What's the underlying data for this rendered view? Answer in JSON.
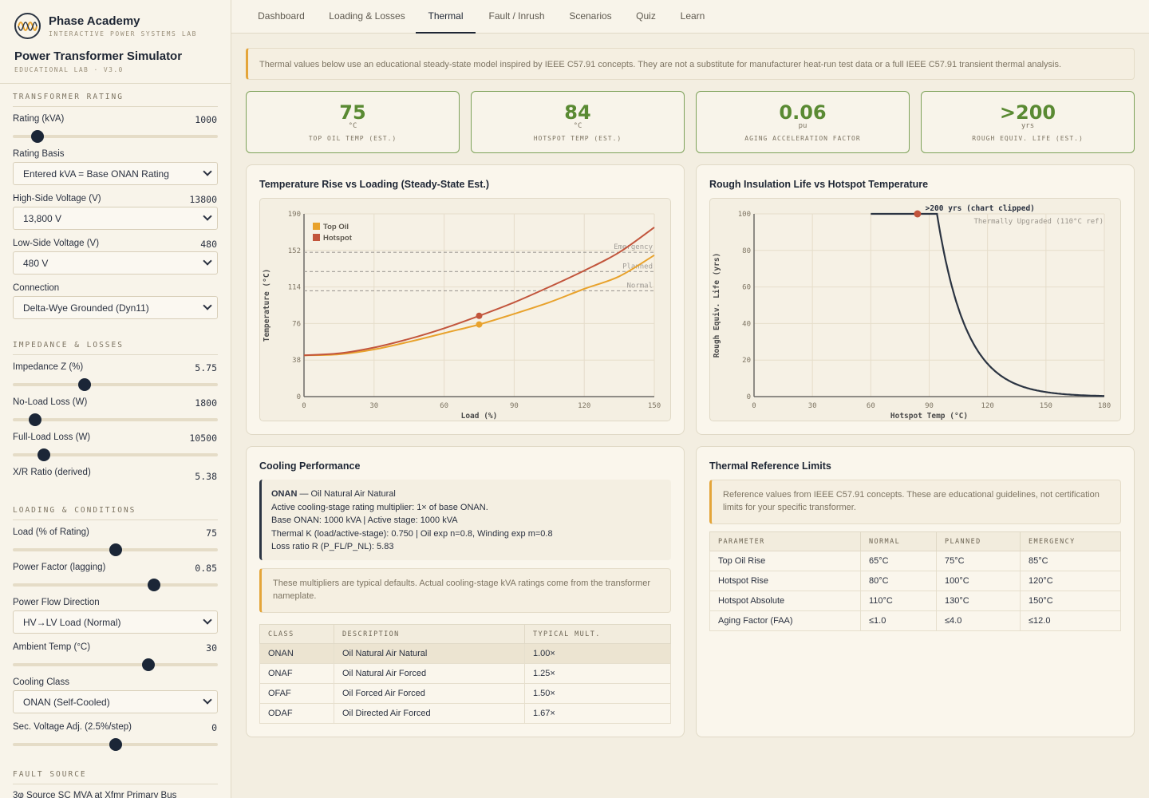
{
  "brand": {
    "name": "Phase Academy",
    "subtitle": "INTERACTIVE POWER SYSTEMS LAB"
  },
  "app": {
    "title": "Power Transformer Simulator",
    "version": "EDUCATIONAL LAB · V3.0"
  },
  "sidebar": {
    "rating_section": "TRANSFORMER RATING",
    "rating_label": "Rating (kVA)",
    "rating_value": "1000",
    "rating_fraction": 0.12,
    "rating_basis_label": "Rating Basis",
    "rating_basis_value": "Entered kVA = Base ONAN Rating",
    "hv_label": "High-Side Voltage (V)",
    "hv_value": "13800",
    "hv_select": "13,800 V",
    "lv_label": "Low-Side Voltage (V)",
    "lv_value": "480",
    "lv_select": "480 V",
    "connection_label": "Connection",
    "connection_value": "Delta-Wye Grounded (Dyn11)",
    "impedance_section": "IMPEDANCE & LOSSES",
    "z_label": "Impedance Z (%)",
    "z_value": "5.75",
    "z_fraction": 0.35,
    "nll_label": "No-Load Loss (W)",
    "nll_value": "1800",
    "nll_fraction": 0.11,
    "fll_label": "Full-Load Loss (W)",
    "fll_value": "10500",
    "fll_fraction": 0.15,
    "xr_label": "X/R Ratio (derived)",
    "xr_value": "5.38",
    "loading_section": "LOADING & CONDITIONS",
    "load_label": "Load (% of Rating)",
    "load_value": "75",
    "load_fraction": 0.5,
    "pf_label": "Power Factor (lagging)",
    "pf_value": "0.85",
    "pf_fraction": 0.69,
    "flow_label": "Power Flow Direction",
    "flow_value": "HV→LV Load (Normal)",
    "ambient_label": "Ambient Temp (°C)",
    "ambient_value": "30",
    "ambient_fraction": 0.66,
    "cooling_label": "Cooling Class",
    "cooling_value": "ONAN (Self-Cooled)",
    "tap_label": "Sec. Voltage Adj. (2.5%/step)",
    "tap_value": "0",
    "tap_fraction": 0.5,
    "fault_section": "FAULT SOURCE",
    "fault_label": "3φ Source SC MVA at Xfmr Primary Bus"
  },
  "tabs": [
    "Dashboard",
    "Loading & Losses",
    "Thermal",
    "Fault / Inrush",
    "Scenarios",
    "Quiz",
    "Learn"
  ],
  "notice": "Thermal values below use an educational steady-state model inspired by IEEE C57.91 concepts. They are not a substitute for manufacturer heat-run test data or a full IEEE C57.91 transient thermal analysis.",
  "kpis": [
    {
      "value": "75",
      "unit": "°C",
      "label": "TOP OIL TEMP (EST.)"
    },
    {
      "value": "84",
      "unit": "°C",
      "label": "HOTSPOT TEMP (EST.)"
    },
    {
      "value": "0.06",
      "unit": "pu",
      "label": "AGING ACCELERATION FACTOR"
    },
    {
      "value": ">200",
      "unit": "yrs",
      "label": "ROUGH EQUIV. LIFE (EST.)"
    }
  ],
  "temp_card_title": "Temperature Rise vs Loading (Steady-State Est.)",
  "life_card_title": "Rough Insulation Life vs Hotspot Temperature",
  "cooling_card": {
    "title": "Cooling Performance",
    "class": "ONAN",
    "class_desc": " — Oil Natural Air Natural",
    "line1": "Active cooling-stage rating multiplier: 1× of base ONAN.",
    "line2": "Base ONAN: 1000 kVA | Active stage: 1000 kVA",
    "line3": "Thermal K (load/active-stage): 0.750 | Oil exp n=0.8, Winding exp m=0.8",
    "line4": "Loss ratio R (P_FL/P_NL): 5.83",
    "note": "These multipliers are typical defaults. Actual cooling-stage kVA ratings come from the transformer nameplate.",
    "headers": [
      "CLASS",
      "DESCRIPTION",
      "TYPICAL MULT."
    ],
    "rows": [
      [
        "ONAN",
        "Oil Natural Air Natural",
        "1.00×"
      ],
      [
        "ONAF",
        "Oil Natural Air Forced",
        "1.25×"
      ],
      [
        "OFAF",
        "Oil Forced Air Forced",
        "1.50×"
      ],
      [
        "ODAF",
        "Oil Directed Air Forced",
        "1.67×"
      ]
    ]
  },
  "limits_card": {
    "title": "Thermal Reference Limits",
    "note": "Reference values from IEEE C57.91 concepts. These are educational guidelines, not certification limits for your specific transformer.",
    "headers": [
      "PARAMETER",
      "NORMAL",
      "PLANNED",
      "EMERGENCY"
    ],
    "rows": [
      [
        "Top Oil Rise",
        "65°C",
        "75°C",
        "85°C"
      ],
      [
        "Hotspot Rise",
        "80°C",
        "100°C",
        "120°C"
      ],
      [
        "Hotspot Absolute",
        "110°C",
        "130°C",
        "150°C"
      ],
      [
        "Aging Factor (FAA)",
        "≤1.0",
        "≤4.0",
        "≤12.0"
      ]
    ]
  },
  "chart_data": [
    {
      "type": "line",
      "xlabel": "Load (%)",
      "ylabel": "Temperature (°C)",
      "xlim": [
        0,
        150
      ],
      "ylim": [
        0,
        190
      ],
      "xticks": [
        0,
        30,
        60,
        90,
        120,
        150
      ],
      "yticks": [
        0,
        38,
        76,
        114,
        152,
        190
      ],
      "legend_placement": "top-left",
      "grid": true,
      "series": [
        {
          "name": "Top Oil",
          "color": "#e8a22c",
          "x": [
            0,
            15,
            30,
            45,
            60,
            75,
            90,
            105,
            120,
            135,
            150
          ],
          "y": [
            43,
            44,
            49,
            57,
            66,
            75,
            86,
            98,
            112,
            125,
            147
          ]
        },
        {
          "name": "Hotspot",
          "color": "#c2553c",
          "x": [
            0,
            15,
            30,
            45,
            60,
            75,
            90,
            105,
            120,
            135,
            150
          ],
          "y": [
            43,
            45,
            51,
            60,
            71,
            84,
            98,
            114,
            131,
            150,
            176
          ]
        }
      ],
      "markers": [
        {
          "series": "Top Oil",
          "x": 75,
          "y": 75
        },
        {
          "series": "Hotspot",
          "x": 75,
          "y": 84
        }
      ],
      "reference_lines": [
        {
          "label": "Emergency",
          "y": 150
        },
        {
          "label": "Planned",
          "y": 130
        },
        {
          "label": "Normal",
          "y": 110
        }
      ]
    },
    {
      "type": "line",
      "xlabel": "Hotspot Temp (°C)",
      "ylabel": "Rough Equiv. Life (yrs)",
      "xlim": [
        0,
        180
      ],
      "ylim": [
        0,
        100
      ],
      "xticks": [
        0,
        30,
        60,
        90,
        120,
        150,
        180
      ],
      "yticks": [
        0,
        20,
        40,
        60,
        80,
        100
      ],
      "grid": true,
      "series": [
        {
          "color": "#2b3442",
          "x": [
            60,
            70,
            80,
            90,
            95,
            100,
            105,
            110,
            115,
            120,
            130,
            140,
            150,
            160,
            170,
            180
          ],
          "y": [
            100,
            100,
            100,
            100,
            100,
            72,
            52,
            37,
            26,
            18,
            8.5,
            4,
            1.9,
            0.9,
            0.5,
            0.3
          ]
        }
      ],
      "marker": {
        "x": 84,
        "y": 100
      },
      "annotations": [
        ">200 yrs (chart clipped)",
        "Thermally Upgraded (110°C ref)"
      ]
    }
  ]
}
